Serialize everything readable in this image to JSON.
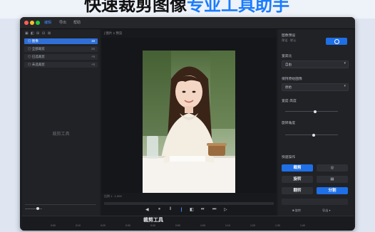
{
  "banner": {
    "text_dark": "快速裁剪图像",
    "text_blue": "专业工具助手"
  },
  "window": {
    "menu": [
      "编辑",
      "导出",
      "帮助"
    ],
    "left_panel": {
      "toolbar": [
        "▣",
        "◧",
        "⊞",
        "⊟",
        "⊠"
      ],
      "items": [
        {
          "label": "◎ 图像",
          "count": "18"
        },
        {
          "label": "◎ 全部裁剪",
          "count": "26"
        },
        {
          "label": "◎ 已选裁剪",
          "count": "+9"
        },
        {
          "label": "◎ 未选裁剪",
          "count": "+8"
        }
      ],
      "empty_hint": "裁剪工具"
    },
    "center": {
      "tab": "| 图片 1 预览",
      "caption": "比例 1 : 1.000",
      "controls": [
        "◀",
        "⏸",
        "‖",
        "❙",
        "◧",
        "⏯",
        "⏭",
        "▷"
      ]
    },
    "right_panel": {
      "section1_title": "图像预设",
      "section1_sub": "预设 · 默认",
      "section2_title": "宽高比",
      "select1": "自由",
      "section3_title": "保持原始图像",
      "select2": "原始",
      "section4_title": "宽度·高度",
      "section5_title": "旋转角度",
      "section6_title": "快速操作",
      "buttons": [
        "裁剪",
        "◎",
        "旋转",
        "▤",
        "翻转",
        "分割"
      ],
      "footer": [
        "■ 旋转",
        "导出 ▾"
      ]
    },
    "bottom": {
      "title": "裁剪工具",
      "ruler": [
        "0:00",
        "0:10",
        "0:20",
        "0:30",
        "0:40",
        "0:50",
        "1:00",
        "1:10",
        "1:20",
        "1:30",
        "1:40"
      ]
    }
  }
}
